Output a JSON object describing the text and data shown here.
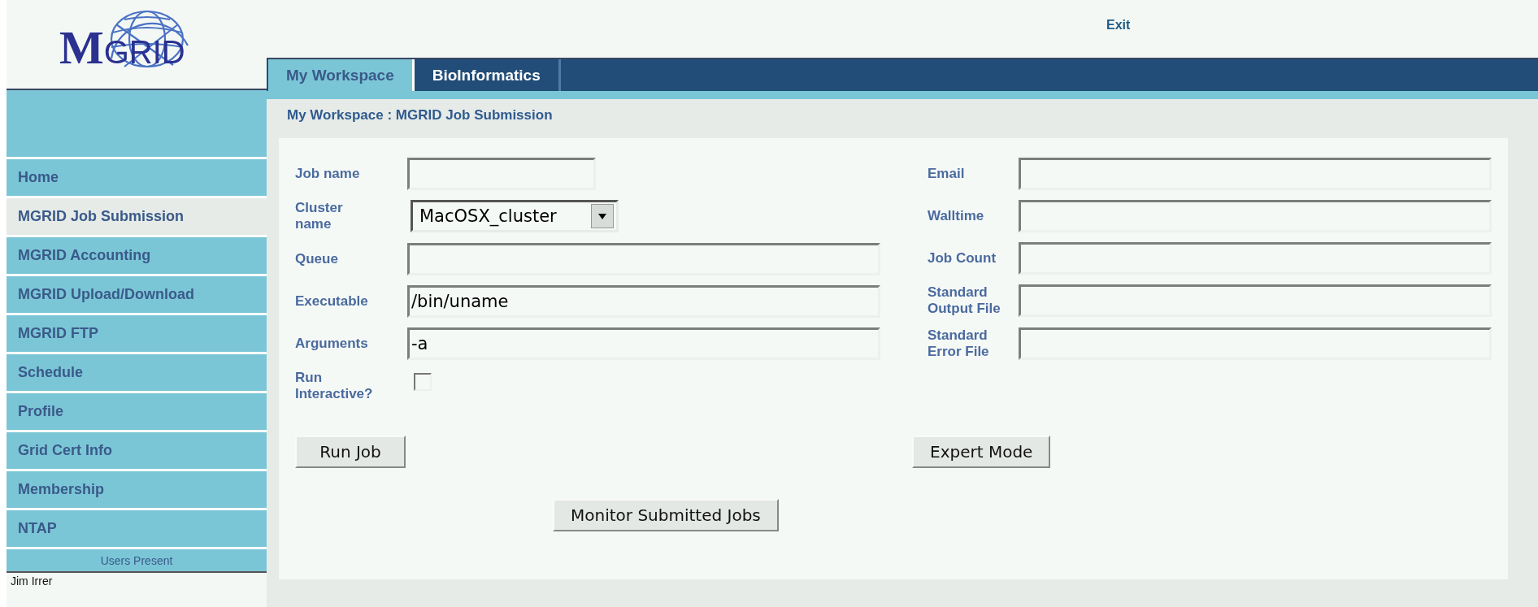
{
  "logo_text": "MGRID",
  "header": {
    "exit_link": "Exit"
  },
  "tabs": [
    {
      "label": "My Workspace",
      "selected": true
    },
    {
      "label": "BioInformatics",
      "selected": false
    }
  ],
  "breadcrumb": "My Workspace : MGRID Job Submission",
  "sidebar": {
    "items": [
      {
        "label": "Home",
        "selected": false
      },
      {
        "label": "MGRID Job Submission",
        "selected": true
      },
      {
        "label": "MGRID Accounting",
        "selected": false
      },
      {
        "label": "MGRID Upload/Download",
        "selected": false
      },
      {
        "label": "MGRID FTP",
        "selected": false
      },
      {
        "label": "Schedule",
        "selected": false
      },
      {
        "label": "Profile",
        "selected": false
      },
      {
        "label": "Grid Cert Info",
        "selected": false
      },
      {
        "label": "Membership",
        "selected": false
      },
      {
        "label": "NTAP",
        "selected": false
      }
    ],
    "users_heading": "Users Present",
    "users": [
      "Jim Irrer"
    ]
  },
  "form": {
    "left": [
      {
        "kind": "shorttext",
        "label": "Job name"
      },
      {
        "kind": "select",
        "label": "Cluster name",
        "value": "MacOSX_cluster"
      },
      {
        "kind": "text",
        "label": "Queue"
      },
      {
        "kind": "text",
        "label": "Executable",
        "value": "/bin/uname"
      },
      {
        "kind": "text",
        "label": "Arguments",
        "value": "-a"
      },
      {
        "kind": "checkbox",
        "label": "Run Interactive?",
        "checked": false
      }
    ],
    "right": [
      {
        "kind": "text",
        "label": "Email"
      },
      {
        "kind": "text",
        "label": "Walltime"
      },
      {
        "kind": "text",
        "label": "Job Count"
      },
      {
        "kind": "text",
        "label": "Standard Output File"
      },
      {
        "kind": "text",
        "label": "Standard Error File"
      }
    ],
    "run_button": "Run Job",
    "expert_button": "Expert Mode",
    "monitor_button": "Monitor Submitted Jobs"
  }
}
